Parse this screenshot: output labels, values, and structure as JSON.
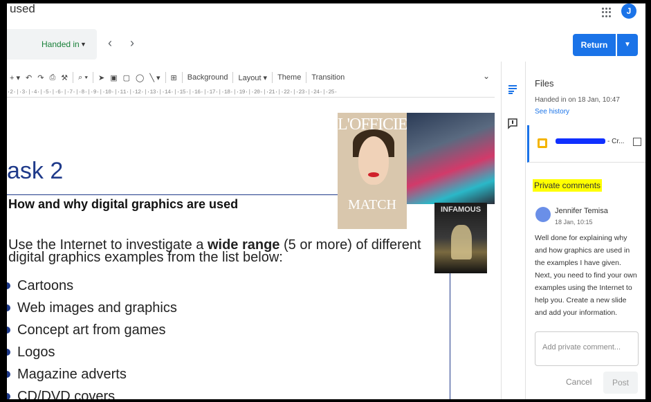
{
  "header": {
    "doc_title": "used",
    "avatar_initial": "J"
  },
  "status": {
    "state_label": "Handed in",
    "return_label": "Return"
  },
  "toolbar": {
    "background_label": "Background",
    "layout_label": "Layout",
    "theme_label": "Theme",
    "transition_label": "Transition"
  },
  "ruler": "·2·|·3·|·4·|·5·|·6·|·7·|·8·|·9·|·10·|·11·|·12·|·13·|·14·|·15·|·16·|·17·|·18·|·19·|·20·|·21·|·22·|·23·|·24·|·25·",
  "slide": {
    "title": "ask 2",
    "subtitle": "How and why digital graphics are used",
    "intro_prefix": "Use the Internet to investigate a ",
    "intro_bold": "wide range",
    "intro_suffix": " (5 or more) of different digital graphics examples from the list below:",
    "bullets": [
      "Cartoons",
      "Web images and graphics",
      "Concept art from games",
      "Logos",
      "Magazine adverts",
      "CD/DVD covers"
    ],
    "magazine_title": "L'OFFICIEL",
    "magazine_bottom": "MATCH",
    "game_title": "INFAMOUS"
  },
  "panel": {
    "files_heading": "Files",
    "handed_on": "Handed in on 18 Jan, 10:47",
    "see_history": "See history",
    "file_suffix": "- Cr...",
    "private_heading": "Private comments",
    "comment_author": "Jennifer Temisa",
    "comment_time": "18 Jan, 10:15",
    "comment_text": "Well done for explaining why and how graphics are used in the examples I have given.  Next, you need to find your own  examples using the Internet to help you. Create a new slide and add your information.",
    "comment_placeholder": "Add private comment...",
    "cancel_label": "Cancel",
    "post_label": "Post"
  },
  "colors": {
    "accent": "#1a73e8",
    "handed_in_green": "#188038",
    "slide_title_blue": "#1f3a8a",
    "highlight": "#ffff00"
  }
}
